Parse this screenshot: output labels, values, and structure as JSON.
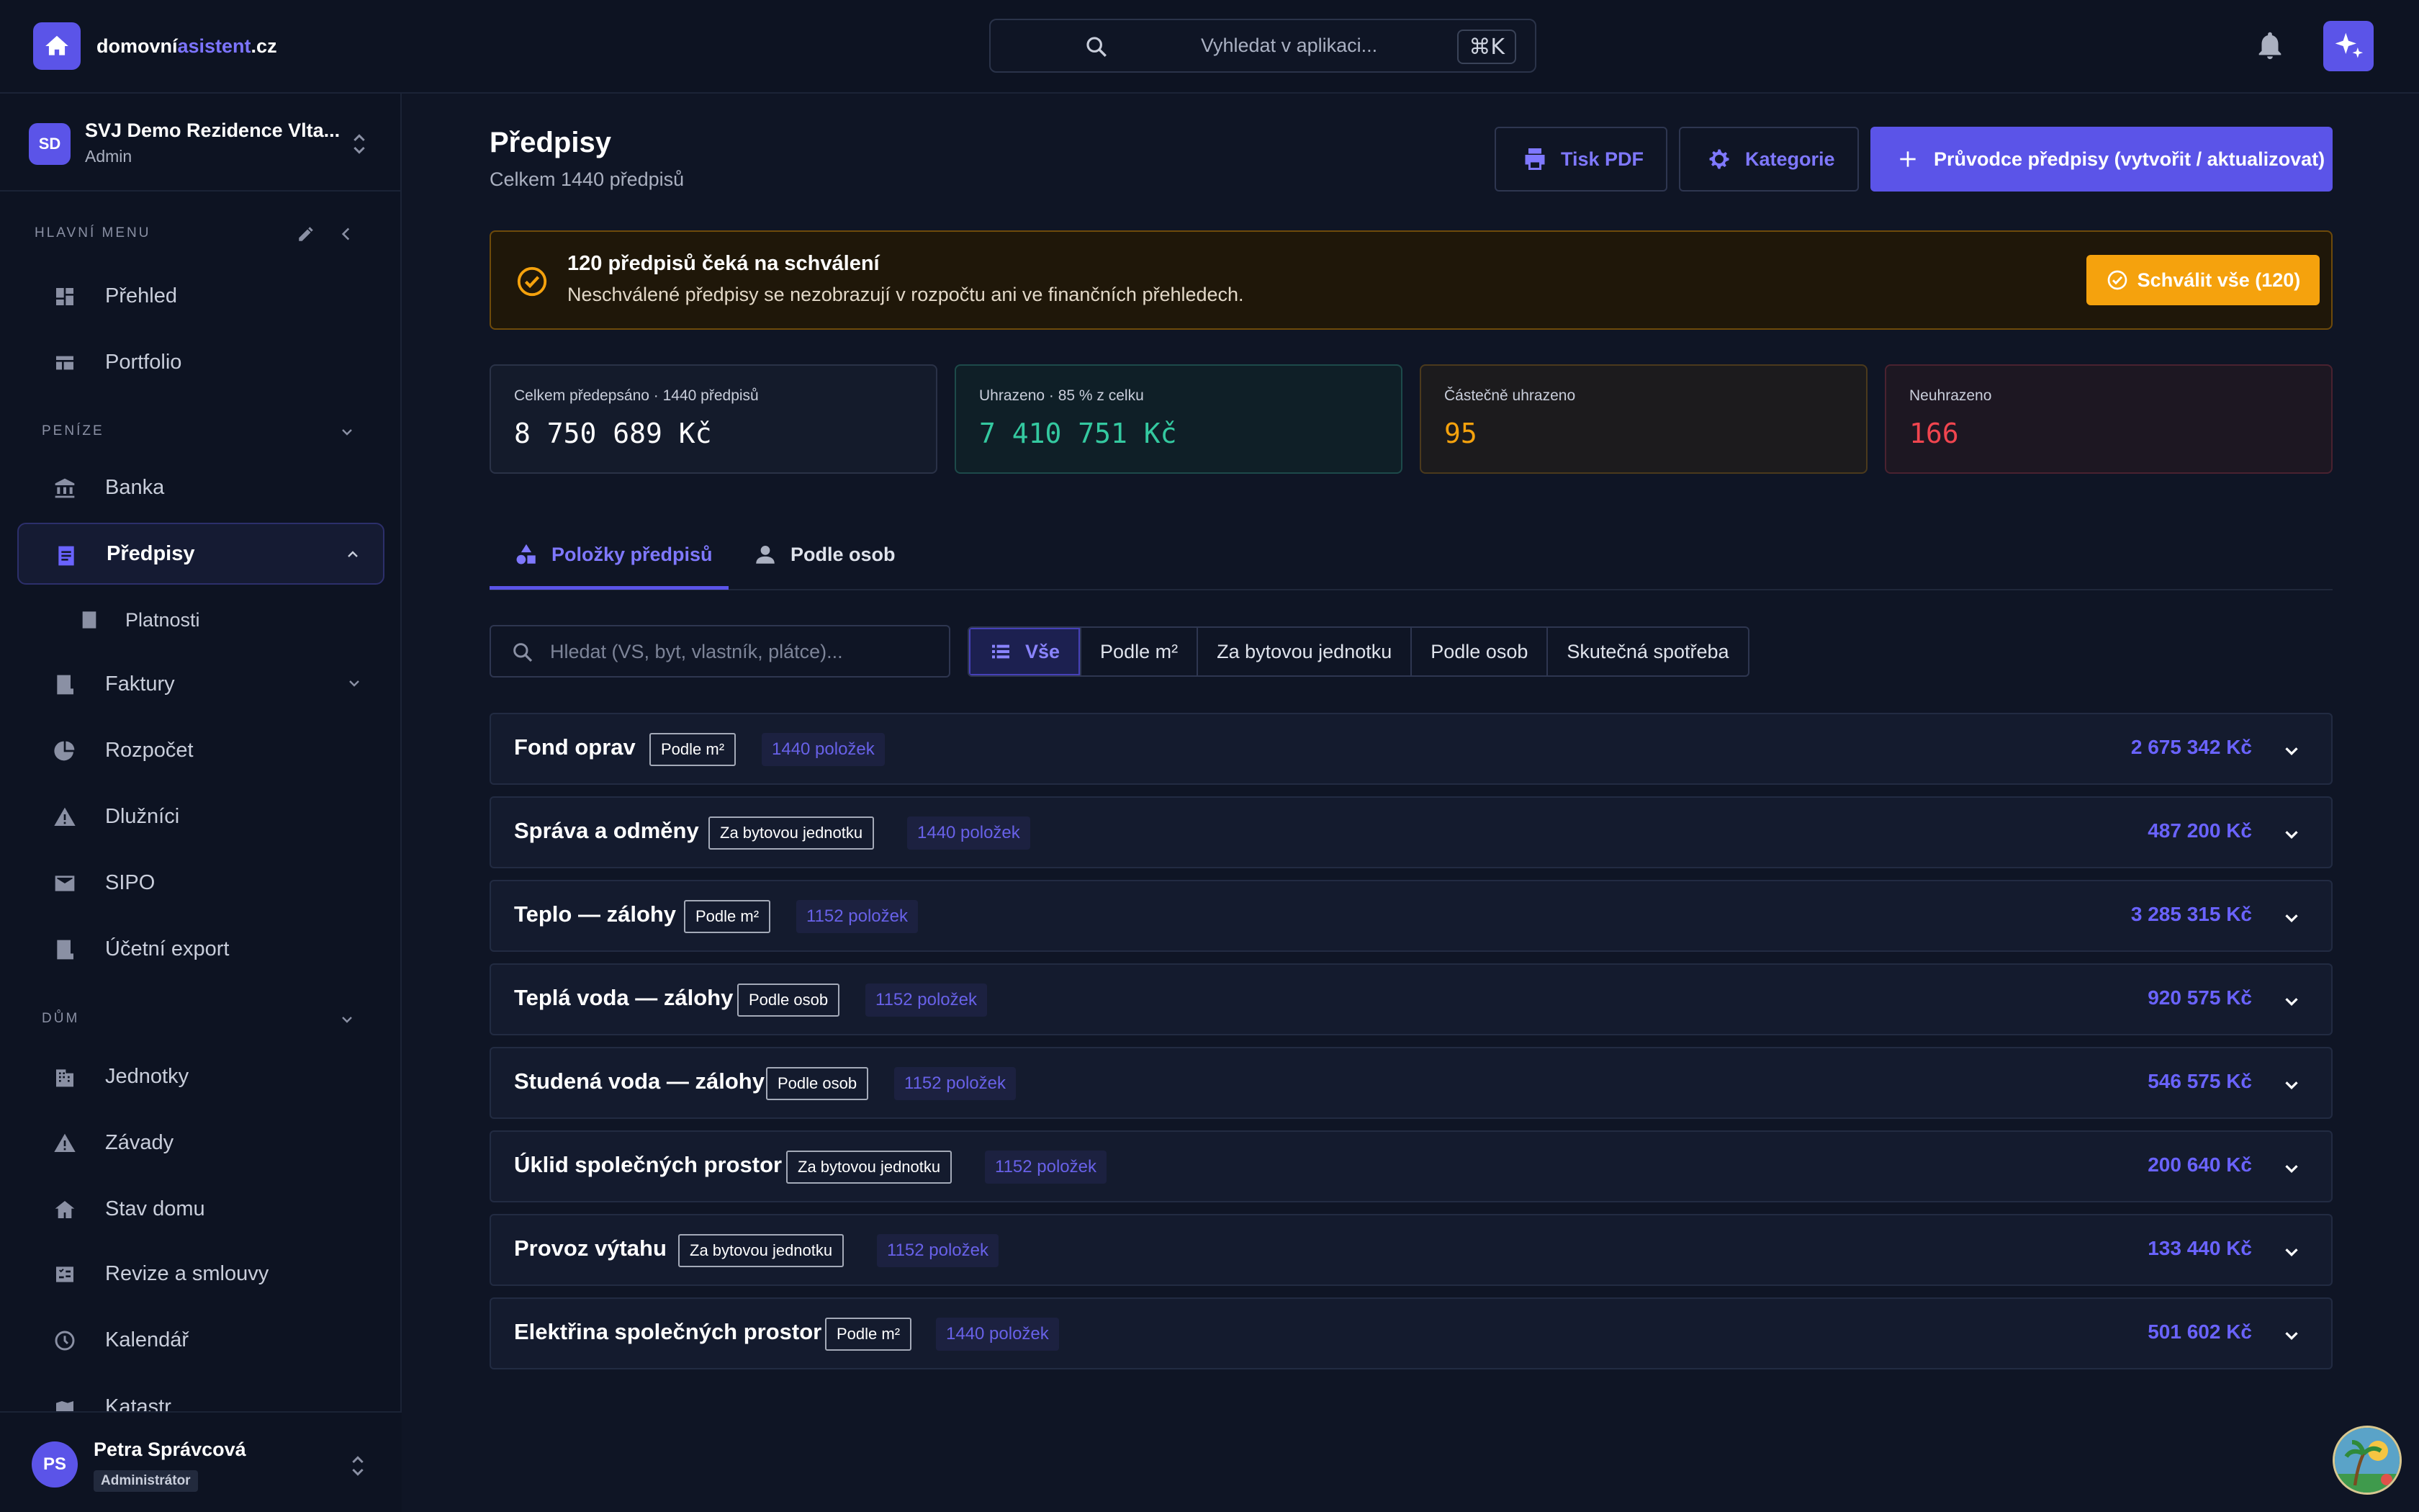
{
  "brand": {
    "name_part1": "domovní",
    "name_part2": "asistent",
    "name_part3": ".cz"
  },
  "search": {
    "placeholder": "Vyhledat v aplikaci...",
    "shortcut": "⌘K"
  },
  "org": {
    "initials": "SD",
    "name": "SVJ Demo Rezidence Vlta...",
    "role": "Admin"
  },
  "sidebar": {
    "section_main": "HLAVNÍ MENU",
    "section_money": "PENÍZE",
    "section_house": "DŮM",
    "items_main": [
      {
        "label": "Přehled"
      },
      {
        "label": "Portfolio"
      }
    ],
    "items_money": [
      {
        "label": "Banka"
      },
      {
        "label": "Předpisy"
      },
      {
        "label": "Platnosti"
      },
      {
        "label": "Faktury"
      },
      {
        "label": "Rozpočet"
      },
      {
        "label": "Dlužníci"
      },
      {
        "label": "SIPO"
      },
      {
        "label": "Účetní export"
      }
    ],
    "items_house": [
      {
        "label": "Jednotky"
      },
      {
        "label": "Závady"
      },
      {
        "label": "Stav domu"
      },
      {
        "label": "Revize a smlouvy"
      },
      {
        "label": "Kalendář"
      },
      {
        "label": "Katastr"
      }
    ]
  },
  "user": {
    "initials": "PS",
    "name": "Petra Správcová",
    "role": "Administrátor"
  },
  "page": {
    "title": "Předpisy",
    "subtitle": "Celkem 1440 předpisů"
  },
  "actions": {
    "print": "Tisk PDF",
    "categories": "Kategorie",
    "wizard": "Průvodce předpisy (vytvořit / aktualizovat)"
  },
  "alert": {
    "title": "120 předpisů čeká na schválení",
    "text": "Neschválené předpisy se nezobrazují v rozpočtu ani ve finančních přehledech.",
    "button": "Schválit vše (120)"
  },
  "stats": [
    {
      "label": "Celkem předepsáno · 1440 předpisů",
      "value": "8 750 689 Kč",
      "color": "#ffffff"
    },
    {
      "label": "Uhrazeno · 85 % z celku",
      "value": "7 410 751 Kč",
      "color": "#34c9a0"
    },
    {
      "label": "Částečně uhrazeno",
      "value": "95",
      "color": "#f5a20d"
    },
    {
      "label": "Neuhrazeno",
      "value": "166",
      "color": "#f0454f"
    }
  ],
  "tabs": [
    {
      "label": "Položky předpisů"
    },
    {
      "label": "Podle osob"
    }
  ],
  "filter": {
    "placeholder": "Hledat (VS, byt, vlastník, plátce)...",
    "segments": [
      "Vše",
      "Podle m²",
      "Za bytovou jednotku",
      "Podle osob",
      "Skutečná spotřeba"
    ]
  },
  "rows": [
    {
      "title": "Fond oprav",
      "tag": "Podle m²",
      "count": "1440 položek",
      "amount": "2 675 342 Kč"
    },
    {
      "title": "Správa a odměny",
      "tag": "Za bytovou jednotku",
      "count": "1440 položek",
      "amount": "487 200 Kč"
    },
    {
      "title": "Teplo — zálohy",
      "tag": "Podle m²",
      "count": "1152 položek",
      "amount": "3 285 315 Kč"
    },
    {
      "title": "Teplá voda — zálohy",
      "tag": "Podle osob",
      "count": "1152 položek",
      "amount": "920 575 Kč"
    },
    {
      "title": "Studená voda — zálohy",
      "tag": "Podle osob",
      "count": "1152 položek",
      "amount": "546 575 Kč"
    },
    {
      "title": "Úklid společných prostor",
      "tag": "Za bytovou jednotku",
      "count": "1152 položek",
      "amount": "200 640 Kč"
    },
    {
      "title": "Provoz výtahu",
      "tag": "Za bytovou jednotku",
      "count": "1152 položek",
      "amount": "133 440 Kč"
    },
    {
      "title": "Elektřina společných prostor",
      "tag": "Podle m²",
      "count": "1440 položek",
      "amount": "501 602 Kč"
    }
  ]
}
